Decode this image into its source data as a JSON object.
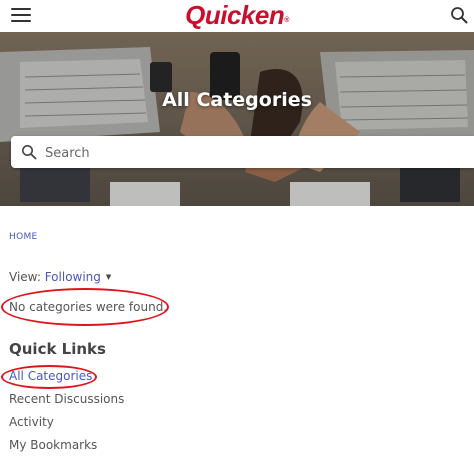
{
  "header": {
    "logo_text": "Quicken",
    "logo_mark": "®",
    "menu_icon": "hamburger-menu-icon",
    "search_icon": "search-icon",
    "brand_color": "#c8102e"
  },
  "hero": {
    "title": "All Categories",
    "search_placeholder": "Search"
  },
  "breadcrumb": {
    "home": "HOME"
  },
  "view": {
    "label": "View:",
    "value": "Following",
    "caret": "▼"
  },
  "status": {
    "message": "No categories were found."
  },
  "quick_links": {
    "title": "Quick Links",
    "items": [
      {
        "label": "All Categories",
        "active": true
      },
      {
        "label": "Recent Discussions",
        "active": false
      },
      {
        "label": "Activity",
        "active": false
      },
      {
        "label": "My Bookmarks",
        "active": false
      }
    ]
  },
  "colors": {
    "link": "#4a58b8",
    "annotation": "#e0141e"
  }
}
